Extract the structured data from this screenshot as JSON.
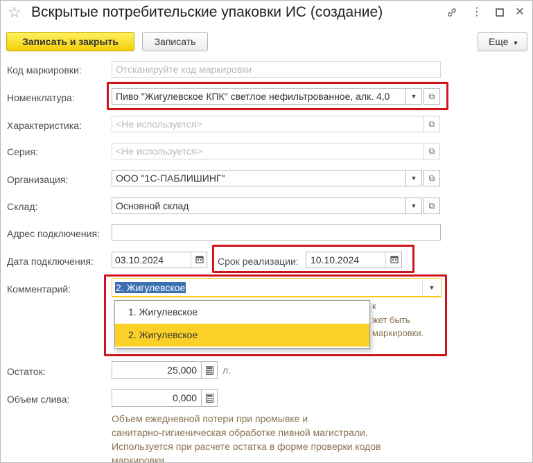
{
  "window": {
    "title": "Вскрытые потребительские упаковки ИС (создание)"
  },
  "toolbar": {
    "save_close_label": "Записать и закрыть",
    "save_label": "Записать",
    "more_label": "Еще"
  },
  "fields": {
    "code_label": "Код маркировки:",
    "code_placeholder": "Отсканируйте код маркировки",
    "nomenclature_label": "Номенклатура:",
    "nomenclature_value": "Пиво \"Жигулевское КПК\" светлое нефильтрованное, алк. 4,0",
    "characteristic_label": "Характеристика:",
    "characteristic_value": "<Не используется>",
    "series_label": "Серия:",
    "series_value": "<Не используется>",
    "organization_label": "Организация:",
    "organization_value": "ООО \"1С-ПАБЛИШИНГ\"",
    "warehouse_label": "Склад:",
    "warehouse_value": "Основной склад",
    "address_label": "Адрес подключения:",
    "address_value": "",
    "connect_date_label": "Дата подключения:",
    "connect_date_value": "03.10.2024",
    "expiry_label": "Срок реализации:",
    "expiry_value": "10.10.2024",
    "comment_label": "Комментарий:",
    "comment_value": "2. Жигулевское",
    "comment_options": [
      "1. Жигулевское",
      "2. Жигулевское"
    ],
    "remainder_label": "Остаток:",
    "remainder_value": "25,000",
    "remainder_unit": "л.",
    "drain_label": "Объем слива:",
    "drain_value": "0,000"
  },
  "partial_hint_fragments": [
    "к",
    "жет быть",
    "маркировки."
  ],
  "drain_hint": [
    "Объем ежедневной потери при промывке и",
    "санитарно-гигиеническая обработке пивной магистрали.",
    "Используется при расчете остатка в форме проверки кодов",
    "маркировки."
  ],
  "colors": {
    "primary_button": "#f3ce05",
    "highlight_border": "#d1141c",
    "selected_item": "#fbd128",
    "text_selection": "#3d6fb3",
    "hint_text": "#8b7352"
  }
}
